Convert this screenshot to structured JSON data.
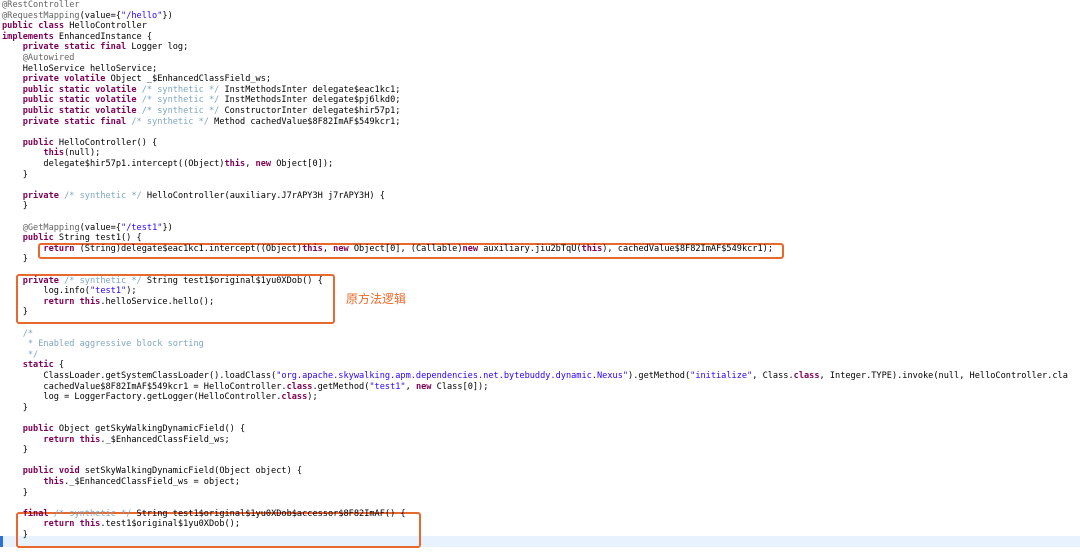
{
  "editor": {
    "note": "原方法逻辑",
    "lines": [
      [
        [
          "an",
          "@RestController"
        ]
      ],
      [
        [
          "an",
          "@RequestMapping"
        ],
        [
          "",
          "(value={"
        ],
        [
          "st",
          "\"/hello\""
        ],
        [
          "",
          "})"
        ]
      ],
      [
        [
          "kw",
          "public class "
        ],
        [
          "",
          "HelloController"
        ]
      ],
      [
        [
          "kw",
          "implements "
        ],
        [
          "",
          "EnhancedInstance {"
        ]
      ],
      [
        [
          "",
          "    "
        ],
        [
          "kw",
          "private static final "
        ],
        [
          "",
          "Logger log;"
        ]
      ],
      [
        [
          "",
          "    "
        ],
        [
          "an",
          "@Autowired"
        ]
      ],
      [
        [
          "",
          "    HelloService helloService;"
        ]
      ],
      [
        [
          "",
          "    "
        ],
        [
          "kw",
          "private volatile "
        ],
        [
          "",
          "Object _$EnhancedClassField_ws;"
        ]
      ],
      [
        [
          "",
          "    "
        ],
        [
          "kw",
          "public static volatile "
        ],
        [
          "cm",
          "/* synthetic */ "
        ],
        [
          "",
          "InstMethodsInter delegate$eac1kc1;"
        ]
      ],
      [
        [
          "",
          "    "
        ],
        [
          "kw",
          "public static volatile "
        ],
        [
          "cm",
          "/* synthetic */ "
        ],
        [
          "",
          "InstMethodsInter delegate$pj6lkd0;"
        ]
      ],
      [
        [
          "",
          "    "
        ],
        [
          "kw",
          "public static volatile "
        ],
        [
          "cm",
          "/* synthetic */ "
        ],
        [
          "",
          "ConstructorInter delegate$hir57p1;"
        ]
      ],
      [
        [
          "",
          "    "
        ],
        [
          "kw",
          "private static final "
        ],
        [
          "cm",
          "/* synthetic */ "
        ],
        [
          "",
          "Method cachedValue$8F82ImAF$549kcr1;"
        ]
      ],
      [
        [
          "",
          ""
        ]
      ],
      [
        [
          "",
          "    "
        ],
        [
          "kw",
          "public "
        ],
        [
          "",
          "HelloController() {"
        ]
      ],
      [
        [
          "",
          "        "
        ],
        [
          "kw",
          "this"
        ],
        [
          "",
          "(null);"
        ]
      ],
      [
        [
          "",
          "        delegate$hir57p1.intercept((Object)"
        ],
        [
          "kw",
          "this"
        ],
        [
          "",
          ", "
        ],
        [
          "kw",
          "new "
        ],
        [
          "",
          "Object[0]);"
        ]
      ],
      [
        [
          "",
          "    }"
        ]
      ],
      [
        [
          "",
          ""
        ]
      ],
      [
        [
          "",
          "    "
        ],
        [
          "kw",
          "private "
        ],
        [
          "cm",
          "/* synthetic */ "
        ],
        [
          "",
          "HelloController(auxiliary.J7rAPY3H j7rAPY3H) {"
        ]
      ],
      [
        [
          "",
          "    }"
        ]
      ],
      [
        [
          "",
          ""
        ]
      ],
      [
        [
          "",
          "    "
        ],
        [
          "an",
          "@GetMapping"
        ],
        [
          "",
          "(value={"
        ],
        [
          "st",
          "\"/test1\""
        ],
        [
          "",
          "})"
        ]
      ],
      [
        [
          "",
          "    "
        ],
        [
          "kw",
          "public "
        ],
        [
          "",
          "String test1() {"
        ]
      ],
      [
        [
          "",
          "        "
        ],
        [
          "kw",
          "return "
        ],
        [
          "",
          "(String)delegate$eac1kc1.intercept((Object)"
        ],
        [
          "kw",
          "this"
        ],
        [
          "",
          ", "
        ],
        [
          "kw",
          "new "
        ],
        [
          "",
          "Object[0], (Callable)"
        ],
        [
          "kw",
          "new "
        ],
        [
          "",
          "auxiliary.jiu2bTqU("
        ],
        [
          "kw",
          "this"
        ],
        [
          "",
          "), cachedValue$8F82ImAF$549kcr1);"
        ]
      ],
      [
        [
          "",
          "    }"
        ]
      ],
      [
        [
          "",
          ""
        ]
      ],
      [
        [
          "",
          "    "
        ],
        [
          "kw",
          "private "
        ],
        [
          "cm",
          "/* synthetic */ "
        ],
        [
          "",
          "String test1$original$1yu0XDob() {"
        ]
      ],
      [
        [
          "",
          "        log.info("
        ],
        [
          "st",
          "\"test1\""
        ],
        [
          "",
          ");"
        ]
      ],
      [
        [
          "",
          "        "
        ],
        [
          "kw",
          "return this"
        ],
        [
          "",
          ".helloService.hello();"
        ]
      ],
      [
        [
          "",
          "    }"
        ]
      ],
      [
        [
          "",
          ""
        ]
      ],
      [
        [
          "",
          "    "
        ],
        [
          "cm",
          "/*"
        ]
      ],
      [
        [
          "",
          "     "
        ],
        [
          "cm",
          "* Enabled aggressive block sorting"
        ]
      ],
      [
        [
          "",
          "     "
        ],
        [
          "cm",
          "*/"
        ]
      ],
      [
        [
          "",
          "    "
        ],
        [
          "kw",
          "static "
        ],
        [
          "",
          "{"
        ]
      ],
      [
        [
          "",
          "        ClassLoader.getSystemClassLoader().loadClass("
        ],
        [
          "st",
          "\"org.apache.skywalking.apm.dependencies.net.bytebuddy.dynamic.Nexus\""
        ],
        [
          "",
          ").getMethod("
        ],
        [
          "st",
          "\"initialize\""
        ],
        [
          "",
          ", Class."
        ],
        [
          "kw",
          "class"
        ],
        [
          "",
          ", Integer.TYPE).invoke(null, HelloController.cla"
        ]
      ],
      [
        [
          "",
          "        cachedValue$8F82ImAF$549kcr1 = HelloController."
        ],
        [
          "kw",
          "class"
        ],
        [
          "",
          ".getMethod("
        ],
        [
          "st",
          "\"test1\""
        ],
        [
          "",
          ", "
        ],
        [
          "kw",
          "new "
        ],
        [
          "",
          "Class[0]);"
        ]
      ],
      [
        [
          "",
          "        log = LoggerFactory.getLogger(HelloController."
        ],
        [
          "kw",
          "class"
        ],
        [
          "",
          ");"
        ]
      ],
      [
        [
          "",
          "    }"
        ]
      ],
      [
        [
          "",
          ""
        ]
      ],
      [
        [
          "",
          "    "
        ],
        [
          "kw",
          "public "
        ],
        [
          "",
          "Object getSkyWalkingDynamicField() {"
        ]
      ],
      [
        [
          "",
          "        "
        ],
        [
          "kw",
          "return this"
        ],
        [
          "",
          "._$EnhancedClassField_ws;"
        ]
      ],
      [
        [
          "",
          "    }"
        ]
      ],
      [
        [
          "",
          ""
        ]
      ],
      [
        [
          "",
          "    "
        ],
        [
          "kw",
          "public void "
        ],
        [
          "",
          "setSkyWalkingDynamicField(Object object) {"
        ]
      ],
      [
        [
          "",
          "        "
        ],
        [
          "kw",
          "this"
        ],
        [
          "",
          "._$EnhancedClassField_ws = object;"
        ]
      ],
      [
        [
          "",
          "    }"
        ]
      ],
      [
        [
          "",
          ""
        ]
      ],
      [
        [
          "",
          "    "
        ],
        [
          "kw",
          "final "
        ],
        [
          "cm",
          "/* synthetic */ "
        ],
        [
          "",
          "String test1$original$1yu0XDob$accessor$8F82ImAF() {"
        ]
      ],
      [
        [
          "",
          "        "
        ],
        [
          "kw",
          "return this"
        ],
        [
          "",
          ".test1$original$1yu0XDob();"
        ]
      ],
      [
        [
          "",
          "    }"
        ]
      ]
    ]
  }
}
